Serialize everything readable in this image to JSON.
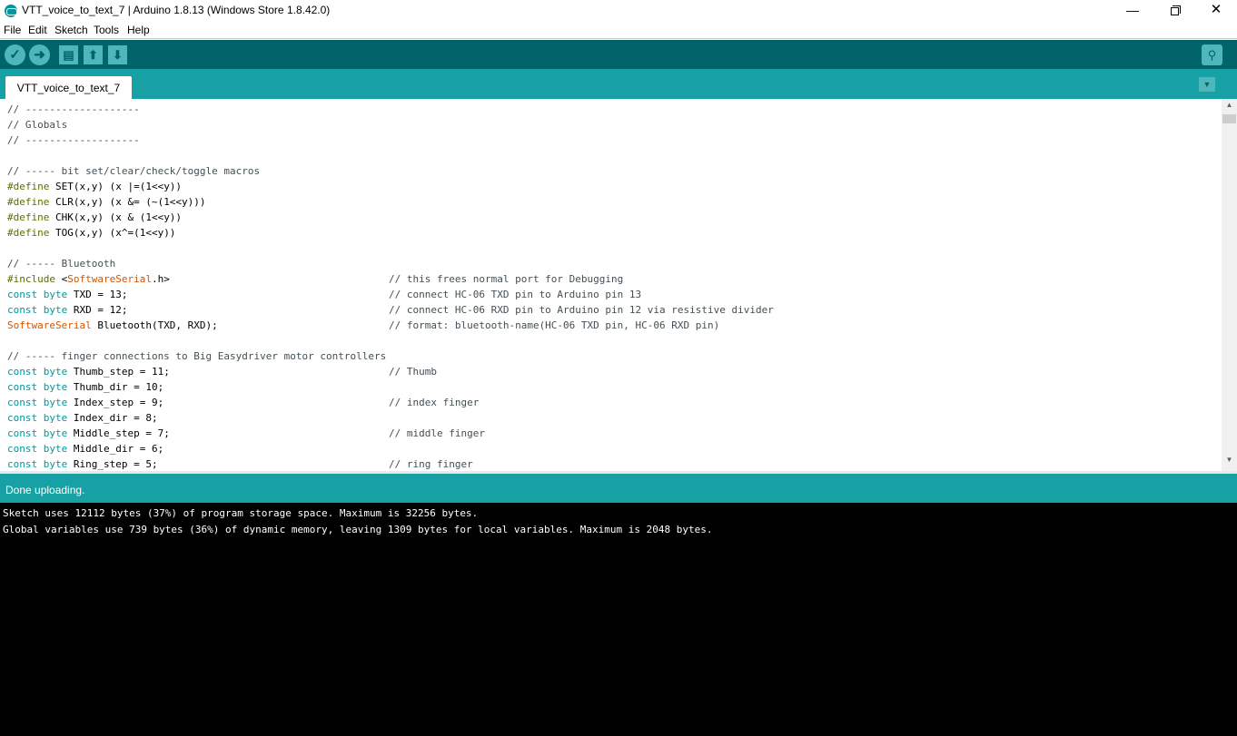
{
  "window": {
    "title": "VTT_voice_to_text_7 | Arduino 1.8.13 (Windows Store 1.8.42.0)",
    "controls": {
      "minimize": "—",
      "maximize": "",
      "close": "✕"
    }
  },
  "menu": {
    "items": [
      {
        "label": "File"
      },
      {
        "label": "Edit"
      },
      {
        "label": "Sketch"
      },
      {
        "label": "Tools"
      },
      {
        "label": "Help"
      }
    ]
  },
  "toolbar": {
    "buttons": [
      {
        "name": "verify",
        "icon": "check-icon",
        "glyph": "✓"
      },
      {
        "name": "upload",
        "icon": "arrow-right-icon",
        "glyph": "➜"
      },
      {
        "name": "new",
        "icon": "new-file-icon",
        "glyph": "▤"
      },
      {
        "name": "open",
        "icon": "arrow-up-icon",
        "glyph": "⬆"
      },
      {
        "name": "save",
        "icon": "arrow-down-icon",
        "glyph": "⬇"
      }
    ],
    "serial_monitor": {
      "icon": "magnifier-icon",
      "glyph": "⚲"
    }
  },
  "tabs": {
    "items": [
      {
        "label": "VTT_voice_to_text_7"
      }
    ],
    "menu_glyph": "▼"
  },
  "editor": {
    "lines": {
      "l1": "// -------------------",
      "l2": "// Globals",
      "l3": "// -------------------",
      "l5": "// ----- bit set/clear/check/toggle macros",
      "l6a": "#define",
      "l6b": " SET(x,y) (x |=(1<<y))",
      "l7a": "#define",
      "l7b": " CLR(x,y) (x &= (~(1<<y)))",
      "l8a": "#define",
      "l8b": " CHK(x,y) (x & (1<<y))",
      "l9a": "#define",
      "l9b": " TOG(x,y) (x^=(1<<y))",
      "l11": "// ----- Bluetooth",
      "l12a": "#include",
      "l12b": " <",
      "l12c": "SoftwareSerial",
      "l12d": ".h>",
      "l12cm": "// this frees normal port for Debugging",
      "l13a": "const",
      "l13b": " ",
      "l13c": "byte",
      "l13d": " TXD = 13;",
      "l13cm": "// connect HC-06 TXD pin to Arduino pin 13",
      "l14a": "const",
      "l14b": " ",
      "l14c": "byte",
      "l14d": " RXD = 12;",
      "l14cm": "// connect HC-06 RXD pin to Arduino pin 12 via resistive divider",
      "l15a": "SoftwareSerial",
      "l15b": " Bluetooth(TXD, RXD);",
      "l15cm": "// format: bluetooth-name(HC-06 TXD pin, HC-06 RXD pin)",
      "l17": "// ----- finger connections to Big Easydriver motor controllers",
      "l18a": "const",
      "l18c": "byte",
      "l18d": " Thumb_step = 11;",
      "l18cm": "// Thumb",
      "l19a": "const",
      "l19c": "byte",
      "l19d": " Thumb_dir = 10;",
      "l20a": "const",
      "l20c": "byte",
      "l20d": " Index_step = 9;",
      "l20cm": "// index finger",
      "l21a": "const",
      "l21c": "byte",
      "l21d": " Index_dir = 8;",
      "l22a": "const",
      "l22c": "byte",
      "l22d": " Middle_step = 7;",
      "l22cm": "// middle finger",
      "l23a": "const",
      "l23c": "byte",
      "l23d": " Middle_dir = 6;",
      "l24a": "const",
      "l24c": "byte",
      "l24d": " Ring_step = 5;",
      "l24cm": "// ring finger"
    },
    "scroll": {
      "up_glyph": "▲",
      "down_glyph": "▼"
    }
  },
  "status": {
    "message": "Done uploading."
  },
  "console": {
    "lines": [
      "Sketch uses 12112 bytes (37%) of program storage space. Maximum is 32256 bytes.",
      "Global variables use 739 bytes (36%) of dynamic memory, leaving 1309 bytes for local variables. Maximum is 2048 bytes."
    ]
  },
  "colors": {
    "toolbar": "#006468",
    "tabbar": "#17a1a5",
    "button": "#4db7bb",
    "keyword": "#00979c",
    "preprocessor": "#5e6d03",
    "type": "#d35400",
    "comment": "#434f54"
  }
}
